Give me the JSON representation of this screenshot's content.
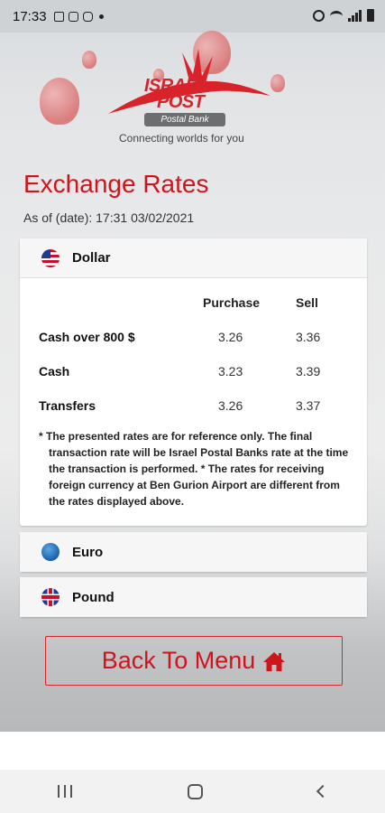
{
  "status_bar": {
    "time": "17:33"
  },
  "header": {
    "brand_line1": "ISRAEL",
    "brand_line2": "POST",
    "sub_brand": "Postal Bank",
    "tagline": "Connecting worlds for you"
  },
  "page": {
    "title": "Exchange Rates",
    "as_of": "As of (date): 17:31 03/02/2021"
  },
  "currencies": [
    {
      "name": "Dollar",
      "icon": "us-flag-icon"
    },
    {
      "name": "Euro",
      "icon": "eu-flag-icon"
    },
    {
      "name": "Pound",
      "icon": "uk-flag-icon"
    }
  ],
  "table": {
    "headers": [
      "Purchase",
      "Sell"
    ],
    "rows": [
      {
        "label": "Cash over 800 $",
        "purchase": "3.26",
        "sell": "3.36"
      },
      {
        "label": "Cash",
        "purchase": "3.23",
        "sell": "3.39"
      },
      {
        "label": "Transfers",
        "purchase": "3.26",
        "sell": "3.37"
      }
    ],
    "note": "* The presented rates are for reference only. The final transaction rate will be Israel Postal Banks rate at the time the transaction is performed. * The rates for receiving foreign currency at Ben Gurion Airport are different from the rates displayed above."
  },
  "actions": {
    "back_label": "Back To Menu",
    "back_icon": "home-icon"
  },
  "colors": {
    "accent": "#d0141d",
    "brand_gray": "#6d6e70"
  }
}
